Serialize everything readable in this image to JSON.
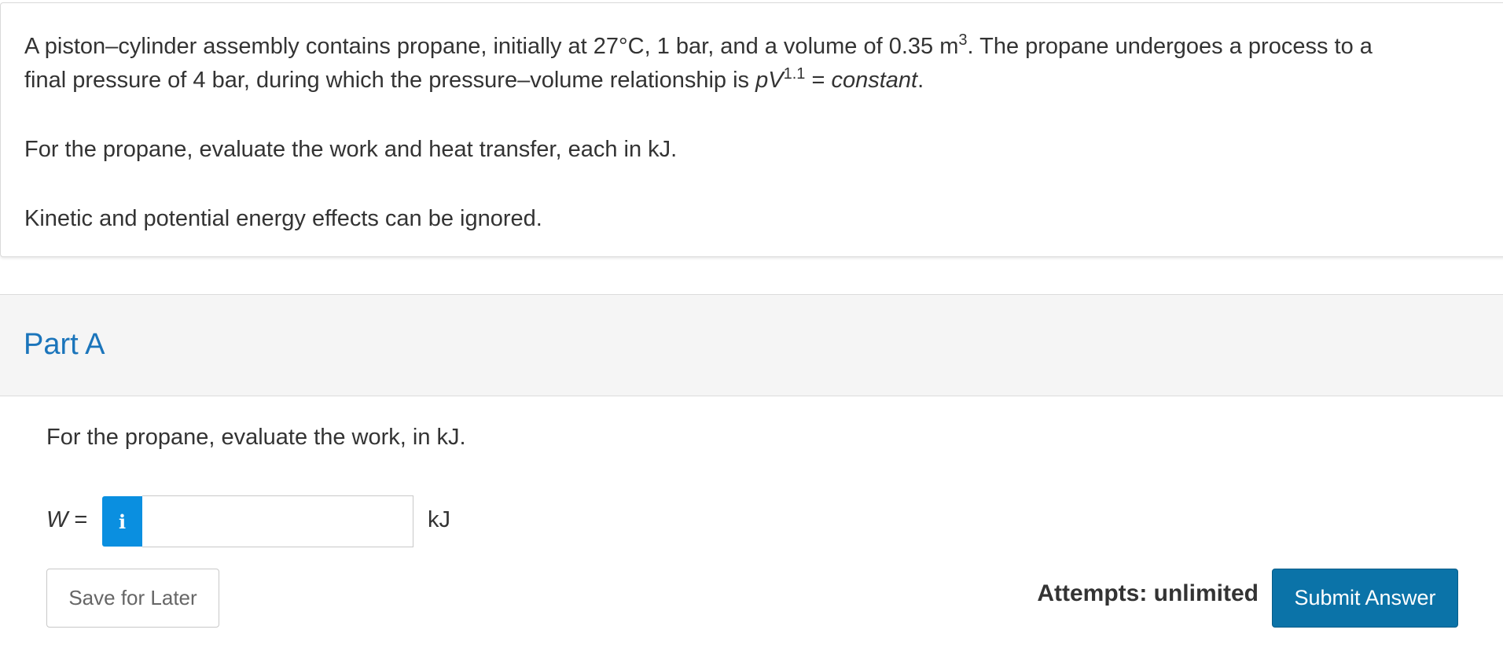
{
  "question": {
    "line1_part1": "A piston–cylinder assembly contains propane, initially at 27°C, 1 bar, and a volume of 0.35 m",
    "line1_sup": "3",
    "line1_part2": ". The propane undergoes a process to a",
    "line2_part1": "final pressure of 4 bar, during which the pressure–volume relationship is ",
    "line2_pv": "pV",
    "line2_sup": "1.1",
    "line2_eq": " = ",
    "line2_const": "constant",
    "line2_end": ".",
    "paragraph2": "For the propane, evaluate the work and heat transfer, each in kJ.",
    "paragraph3": "Kinetic and potential energy effects can be ignored."
  },
  "part": {
    "title": "Part A",
    "prompt": "For the propane, evaluate the work, in kJ.",
    "variable": "W",
    "equals": " =",
    "info_icon": "i",
    "input_value": "",
    "unit": "kJ"
  },
  "actions": {
    "save_label": "Save for Later",
    "attempts_label": "Attempts: unlimited",
    "submit_label": "Submit Answer"
  },
  "colors": {
    "accent_blue": "#1b75bb",
    "info_blue": "#0a8fe0",
    "submit_blue": "#0b73a8"
  }
}
